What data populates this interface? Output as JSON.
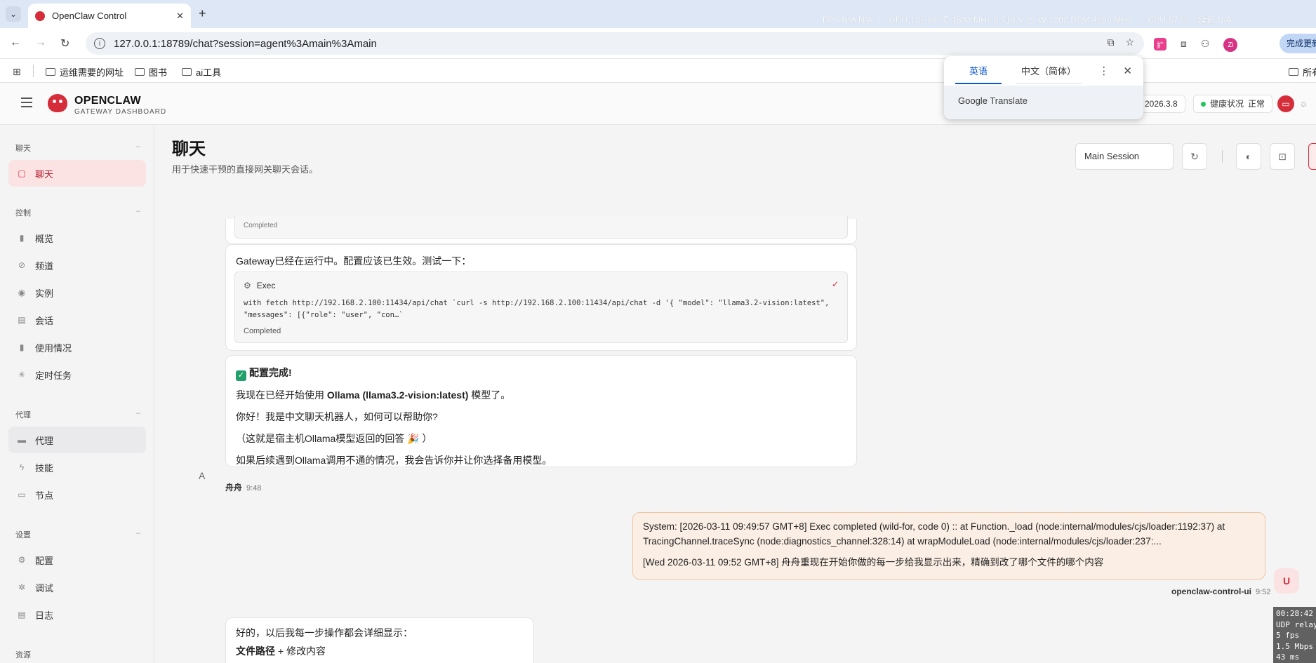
{
  "browser": {
    "tab_title": "OpenClaw Control",
    "url": "127.0.0.1:18789/chat?session=agent%3Amain%3Amain",
    "perf_overlay": {
      "fps": "FPS  N/A  N/A",
      "gpu": "GPU  1 %  36 ℃  1530 MHz  0.718 V  20 W  1202 RPM  4200 MHz",
      "cpu": "CPU  57 %",
      "extra": "延迟  N/A"
    },
    "update_label": "完成更新",
    "avatar_initials": "Zi",
    "ext_badge": "扩",
    "bookmarks": [
      "运维需要的网址",
      "图书",
      "ai工具"
    ],
    "bookmarks_right": "所有"
  },
  "translate_popup": {
    "tab_english": "英语",
    "tab_chinese": "中文（简体）",
    "brand": "Google",
    "product": "Translate"
  },
  "app": {
    "brand_name": "OPENCLAW",
    "brand_sub": "GATEWAY DASHBOARD",
    "version": "2026.3.8",
    "health_label": "健康状况",
    "health_value": "正常"
  },
  "sidebar": {
    "sections": [
      {
        "title": "聊天",
        "items": [
          {
            "label": "聊天",
            "icon": "chat-icon"
          }
        ]
      },
      {
        "title": "控制",
        "items": [
          {
            "label": "概览",
            "icon": "bar-chart-icon"
          },
          {
            "label": "频道",
            "icon": "link-icon"
          },
          {
            "label": "实例",
            "icon": "radio-icon"
          },
          {
            "label": "会话",
            "icon": "document-icon"
          },
          {
            "label": "使用情况",
            "icon": "bar-chart-icon"
          },
          {
            "label": "定时任务",
            "icon": "loader-icon"
          }
        ]
      },
      {
        "title": "代理",
        "items": [
          {
            "label": "代理",
            "icon": "folder-icon"
          },
          {
            "label": "技能",
            "icon": "zap-icon"
          },
          {
            "label": "节点",
            "icon": "monitor-icon"
          }
        ]
      },
      {
        "title": "设置",
        "items": [
          {
            "label": "配置",
            "icon": "gear-icon"
          },
          {
            "label": "调试",
            "icon": "bug-icon"
          },
          {
            "label": "日志",
            "icon": "file-text-icon"
          }
        ]
      },
      {
        "title": "资源",
        "items": []
      }
    ]
  },
  "main": {
    "title": "聊天",
    "subtitle": "用于快速干预的直接网关聊天会话。",
    "session_select": "Main Session",
    "messages": {
      "prev_status": "Completed",
      "gateway_text": "Gateway已经在运行中。配置应该已生效。测试一下：",
      "exec_title": "Exec",
      "exec_cmd_1": "with fetch http://192.168.2.100:11434/api/chat `curl -s http://192.168.2.100:11434/api/chat -d '{ \"model\": \"llama3.2-vision:latest\",",
      "exec_cmd_2": "\"messages\": [{\"role\": \"user\", \"con…`",
      "exec_status": "Completed",
      "done_title": "配置完成!",
      "line1_pre": "我现在已经开始使用 ",
      "line1_bold": "Ollama (llama3.2-vision:latest)",
      "line1_post": " 模型了。",
      "line2": "你好！我是中文聊天机器人，如何可以帮助你?",
      "line3": "（这就是宿主机Ollama模型返回的回答 🎉 ）",
      "line4": "如果后续遇到Ollama调用不通的情况，我会告诉你并让你选择备用模型。",
      "assistant_avatar": "A",
      "assistant_name": "舟舟",
      "assistant_time": "9:48",
      "user_line1": "System: [2026-03-11 09:49:57 GMT+8] Exec completed (wild-for, code 0) :: at Function._load (node:internal/modules/cjs/loader:1192:37) at",
      "user_line2": "TracingChannel.traceSync (node:diagnostics_channel:328:14) at wrapModuleLoad (node:internal/modules/cjs/loader:237:...",
      "user_line3": "[Wed 2026-03-11 09:52 GMT+8] 舟舟重现在开始你做的每一步给我显示出来，精确到改了哪个文件的哪个内容",
      "user_avatar": "U",
      "user_name": "openclaw-control-ui",
      "user_time": "9:52",
      "reply_line1": "好的，以后我每一步操作都会详细显示：",
      "reply_line2_bold": "文件路径",
      "reply_line2_rest": " + 修改内容"
    }
  },
  "stats_overlay": {
    "lines": [
      "00:28:42",
      "UDP relay",
      "5 fps",
      "1.5 Mbps",
      "43 ms"
    ]
  }
}
